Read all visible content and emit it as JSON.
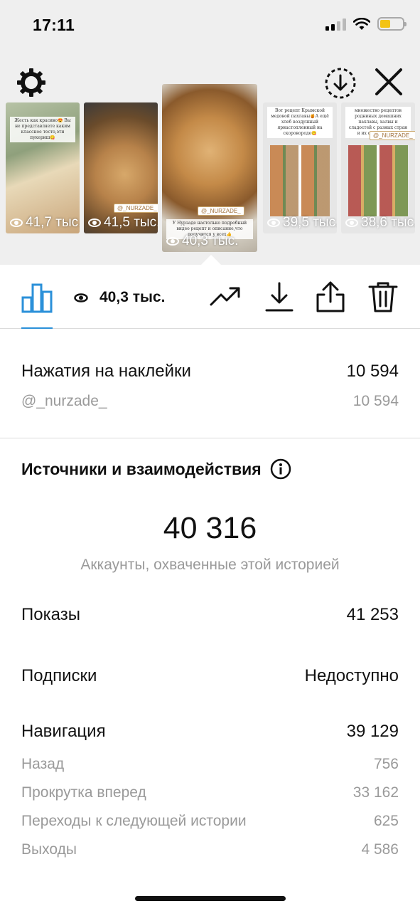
{
  "status_bar": {
    "time": "17:11"
  },
  "top_bar": {
    "settings_icon": "gear-icon",
    "download_icon": "download-circle-icon",
    "close_icon": "close-icon"
  },
  "stories": [
    {
      "views": "41,7 тыс.",
      "caption": "Жесть как красиво😍 Вы не представляете каким классное тесто,эти пукериш😋",
      "tag": ""
    },
    {
      "views": "41,5 тыс.",
      "caption": "",
      "tag": "@_NURZADE_"
    },
    {
      "views": "40,3 тыс.",
      "caption": "У Нурзаде настолько подробный видео рецепт и описание,что получится у всех👍",
      "tag": "@_NURZADE_"
    },
    {
      "views": "39,5 тыс.",
      "caption": "Вот рецепт Крымской медовой пахлавы🍯А ещё хлеб воздушный ярнастопленный на скоровороде😋",
      "tag": ""
    },
    {
      "views": "38,6 тыс.",
      "caption": "множество рецептов родниных домашних пахлавы, халвы и сладостей с разных стран и их особенностей",
      "tag": "@_NURZADE_"
    }
  ],
  "toolbar": {
    "insights_icon": "bar-chart-icon",
    "views": "40,3 тыс.",
    "promote_icon": "trending-up-icon",
    "download_icon": "download-icon",
    "share_icon": "share-icon",
    "delete_icon": "trash-icon"
  },
  "stickers": {
    "label": "Нажатия на наклейки",
    "value": "10 594",
    "sub_label": "@_nurzade_",
    "sub_value": "10 594"
  },
  "sources": {
    "title": "Источники и взаимодействия",
    "reach": "40 316",
    "reach_caption": "Аккаунты, охваченные этой историей",
    "impressions_label": "Показы",
    "impressions_value": "41 253",
    "follows_label": "Подписки",
    "follows_value": "Недоступно",
    "navigation_label": "Навигация",
    "navigation_value": "39 129",
    "navigation_items": [
      {
        "label": "Назад",
        "value": "756"
      },
      {
        "label": "Прокрутка вперед",
        "value": "33 162"
      },
      {
        "label": "Переходы к следующей истории",
        "value": "625"
      },
      {
        "label": "Выходы",
        "value": "4 586"
      }
    ]
  },
  "colors": {
    "accent": "#2b90d9",
    "battery": "#f3c315",
    "muted": "#9a9a9a"
  }
}
